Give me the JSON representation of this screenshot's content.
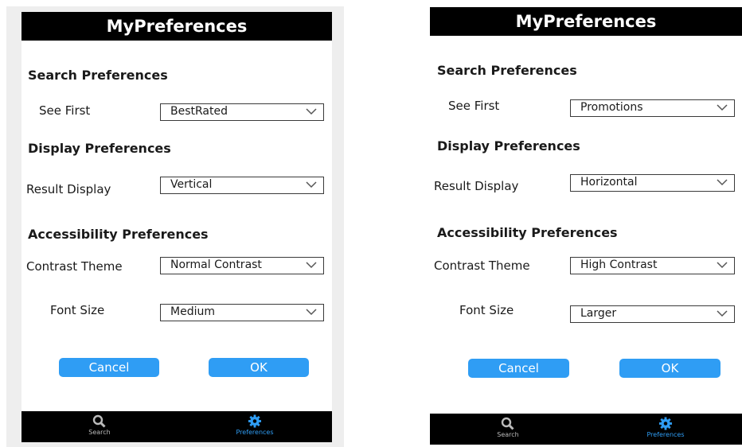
{
  "colors": {
    "header_bg": "#000000",
    "button_bg": "#2f9df4",
    "active_tab": "#2f9df4",
    "inactive_tab": "#bbbbbb"
  },
  "screens": [
    {
      "title": "MyPreferences",
      "search_section": "Search Preferences",
      "see_first_label": "See First",
      "see_first_value": "BestRated",
      "display_section": "Display Preferences",
      "result_display_label": "Result Display",
      "result_display_value": "Vertical",
      "accessibility_section": "Accessibility Preferences",
      "contrast_label": "Contrast Theme",
      "contrast_value": "Normal Contrast",
      "font_size_label": "Font Size",
      "font_size_value": "Medium",
      "cancel_label": "Cancel",
      "ok_label": "OK",
      "nav": {
        "search_label": "Search",
        "preferences_label": "Preferences",
        "search_icon": "search-icon",
        "preferences_icon": "gear-icon",
        "active": "preferences"
      }
    },
    {
      "title": "MyPreferences",
      "search_section": "Search Preferences",
      "see_first_label": "See First",
      "see_first_value": "Promotions",
      "display_section": "Display Preferences",
      "result_display_label": "Result Display",
      "result_display_value": "Horizontal",
      "accessibility_section": "Accessibility Preferences",
      "contrast_label": "Contrast Theme",
      "contrast_value": "High Contrast",
      "font_size_label": "Font Size",
      "font_size_value": "Larger",
      "cancel_label": "Cancel",
      "ok_label": "OK",
      "nav": {
        "search_label": "Search",
        "preferences_label": "Preferences",
        "search_icon": "search-icon",
        "preferences_icon": "gear-icon",
        "active": "preferences"
      }
    }
  ]
}
